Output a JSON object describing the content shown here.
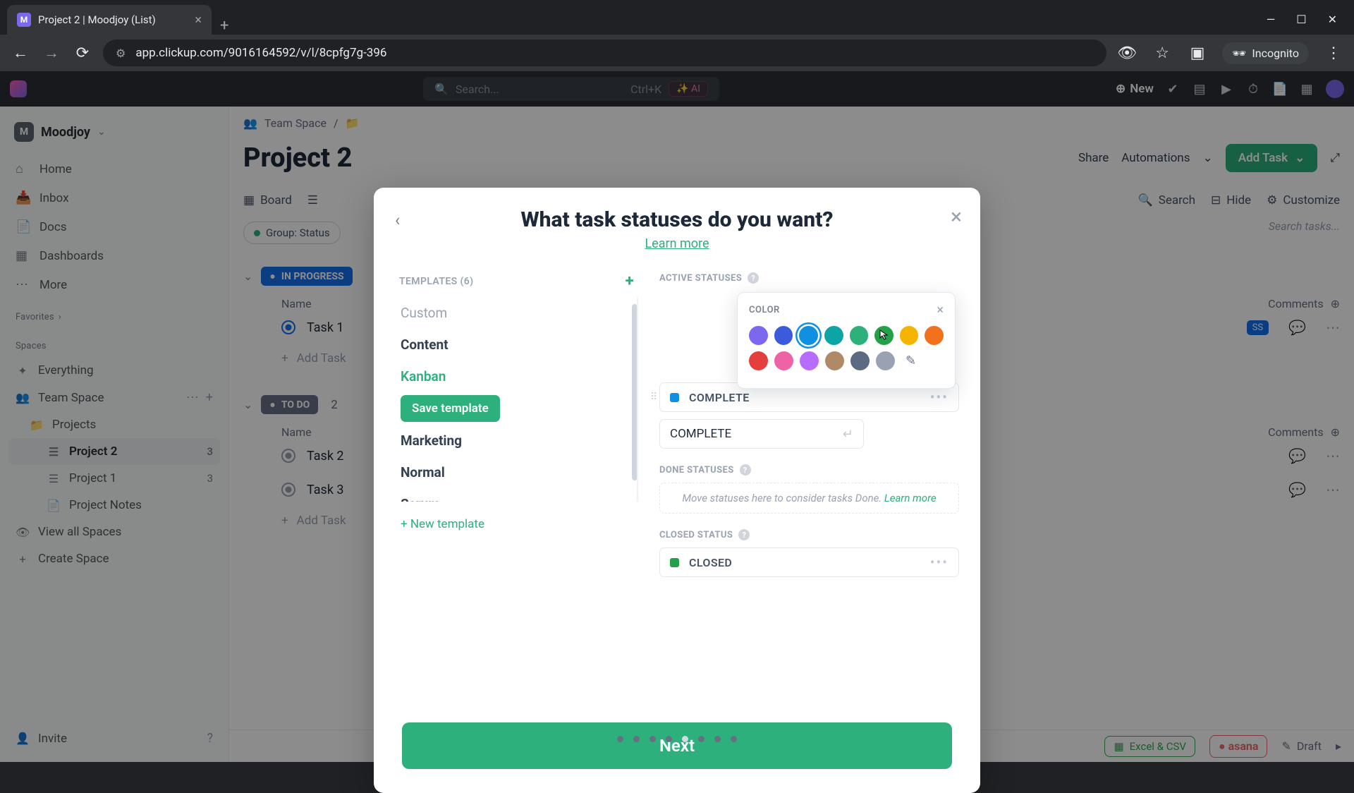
{
  "browser": {
    "tab_title": "Project 2 | Moodjoy (List)",
    "url": "app.clickup.com/9016164592/v/l/8cpfg7g-396",
    "incognito_label": "Incognito"
  },
  "app_header": {
    "search_placeholder": "Search...",
    "search_shortcut": "Ctrl+K",
    "ai_label": "AI",
    "new_label": "New"
  },
  "sidebar": {
    "workspace_initial": "M",
    "workspace_name": "Moodjoy",
    "nav": {
      "home": "Home",
      "inbox": "Inbox",
      "docs": "Docs",
      "dashboards": "Dashboards",
      "more": "More"
    },
    "favorites_label": "Favorites",
    "spaces_label": "Spaces",
    "everything": "Everything",
    "team_space": "Team Space",
    "projects": "Projects",
    "project2": "Project 2",
    "project2_count": "3",
    "project1": "Project 1",
    "project1_count": "3",
    "project_notes": "Project Notes",
    "view_all": "View all Spaces",
    "create_space": "Create Space",
    "invite": "Invite"
  },
  "main": {
    "breadcrumb_space": "Team Space",
    "page_title": "Project 2",
    "share": "Share",
    "automations": "Automations",
    "add_task": "Add Task",
    "tab_board": "Board",
    "search_label": "Search",
    "hide_label": "Hide",
    "customize_label": "Customize",
    "group_label": "Group: Status",
    "search_tasks_placeholder": "Search tasks...",
    "in_progress": "IN PROGRESS",
    "to_do": "TO DO",
    "to_do_count": "2",
    "name_col": "Name",
    "comments_col": "Comments",
    "task1": "Task 1",
    "task2": "Task 2",
    "task3": "Task 3",
    "add_task_row": "Add Task",
    "excel": "Excel & CSV",
    "asana": "asana",
    "draft": "Draft"
  },
  "modal": {
    "title": "What task statuses do you want?",
    "learn_more": "Learn more",
    "templates_head": "TEMPLATES (6)",
    "templates": {
      "custom": "Custom",
      "content": "Content",
      "kanban": "Kanban",
      "save_template": "Save template",
      "marketing": "Marketing",
      "normal": "Normal",
      "scrum": "Scrum"
    },
    "new_template": "+ New template",
    "active_head": "ACTIVE STATUSES",
    "color_label": "COLOR",
    "status_complete": "COMPLETE",
    "status_input_value": "COMPLETE",
    "done_head": "DONE STATUSES",
    "done_hint_pre": "Move statuses here to consider tasks Done. ",
    "done_hint_link": "Learn more",
    "closed_head": "CLOSED STATUS",
    "status_closed": "CLOSED",
    "next": "Next",
    "colors_row1": [
      "#7b68ee",
      "#3b5bdb",
      "#1090e0",
      "#0ba5a5",
      "#2db07c",
      "#24a148",
      "#f5b400",
      "#f2711c"
    ],
    "colors_row2": [
      "#e53e3e",
      "#ed64a6",
      "#b66dff",
      "#b08968",
      "#5d6b82",
      "#98a2b3"
    ]
  }
}
